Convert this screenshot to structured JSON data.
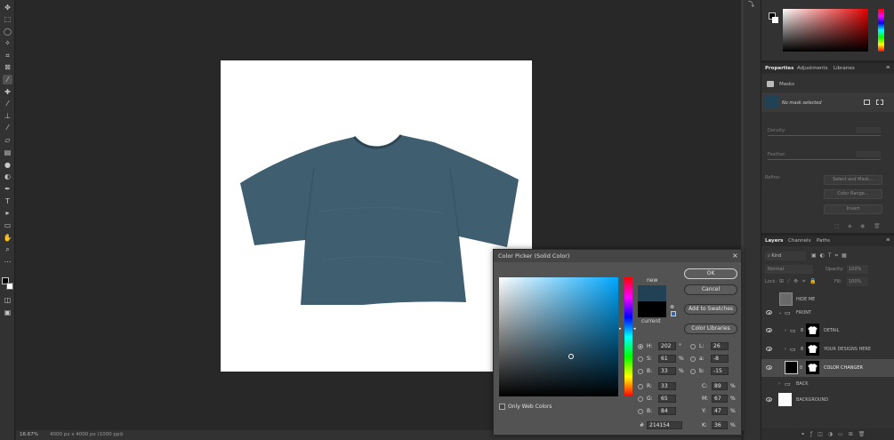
{
  "status": {
    "zoom": "16.67%",
    "doc_info": "4000 px x 4000 px (1000 ppi)"
  },
  "panels": {
    "properties_tabs": [
      "Properties",
      "Adjustments",
      "Libraries"
    ],
    "masks_title": "Masks",
    "mask_status": "No mask selected",
    "density_label": "Density:",
    "feather_label": "Feather:",
    "refine_label": "Refine:",
    "refine_buttons": [
      "Select and Mask...",
      "Color Range...",
      "Invert"
    ],
    "layers_tabs": [
      "Layers",
      "Channels",
      "Paths"
    ],
    "kind_label": "Kind",
    "blend_mode": "Normal",
    "opacity_label": "Opacity:",
    "opacity_value": "100%",
    "lock_label": "Lock:",
    "fill_label": "Fill:",
    "fill_value": "100%"
  },
  "layers": [
    {
      "name": "HIDE ME",
      "visible": false,
      "type": "layer"
    },
    {
      "name": "FRONT",
      "visible": true,
      "type": "group"
    },
    {
      "name": "DETAIL",
      "visible": true,
      "type": "group"
    },
    {
      "name": "YOUR DESIGNS HERE",
      "visible": true,
      "type": "group"
    },
    {
      "name": "COLOR CHANGER",
      "visible": true,
      "type": "layer",
      "selected": true
    },
    {
      "name": "BACK",
      "visible": false,
      "type": "group"
    },
    {
      "name": "BACKGROUND",
      "visible": true,
      "type": "layer"
    }
  ],
  "color_picker": {
    "title": "Color Picker (Solid Color)",
    "ok": "OK",
    "cancel": "Cancel",
    "add_swatches": "Add to Swatches",
    "color_libraries": "Color Libraries",
    "new_label": "new",
    "current_label": "current",
    "new_color": "#214154",
    "current_color": "#000000",
    "only_web_colors": "Only Web Colors",
    "H": "202",
    "H_unit": "°",
    "S": "61",
    "S_unit": "%",
    "B": "33",
    "B_unit": "%",
    "R": "33",
    "G": "65",
    "Bl": "84",
    "L": "26",
    "a": "-8",
    "b": "-15",
    "C": "89",
    "M": "67",
    "Y": "47",
    "K": "36",
    "pct": "%",
    "hex": "214154"
  },
  "colors": {
    "shirt": "#3f5f70",
    "accent": "#31a8ff"
  }
}
